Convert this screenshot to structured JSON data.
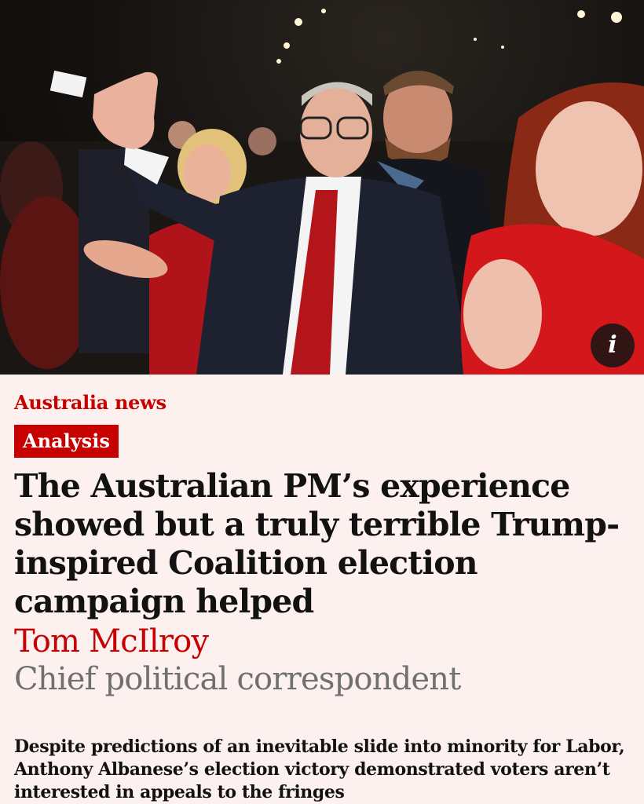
{
  "hero": {
    "photo_description_icon": "info-icon",
    "info_label": "i"
  },
  "article": {
    "section": "Australia news",
    "badge": "Analysis",
    "headline": "The Australian PM’s experience showed but a truly terrible Trump-inspired Coalition election campaign helped",
    "author": "Tom McIlroy",
    "author_role": "Chief political correspondent",
    "standfirst": "Despite predictions of an inevitable slide into minority for Labor, Anthony Albanese’s election victory demonstrated voters aren’t interested in appeals to the fringes"
  },
  "colors": {
    "accent": "#c70000",
    "background": "#fdf1ef",
    "text": "#121212",
    "muted": "#707070"
  }
}
